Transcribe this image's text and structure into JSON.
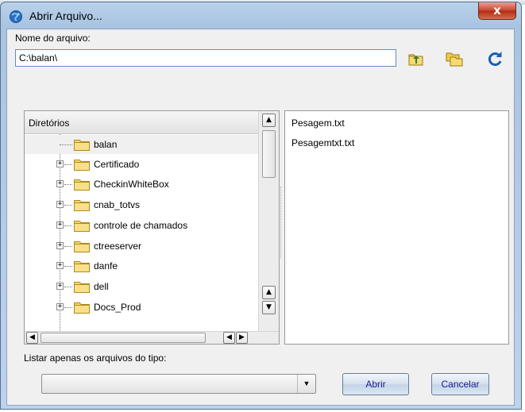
{
  "window": {
    "title": "Abrir Arquivo...",
    "close_symbol": "x"
  },
  "filename": {
    "label": "Nome do arquivo:",
    "value": "C:\\balan\\"
  },
  "toolbar": {
    "up_icon": "folder-up-icon",
    "new_folder_icon": "new-folder-icon",
    "refresh_icon": "refresh-icon"
  },
  "directories": {
    "header": "Diretórios",
    "items": [
      {
        "label": "balan",
        "selected": true,
        "expandable": false
      },
      {
        "label": "Certificado",
        "selected": false,
        "expandable": true
      },
      {
        "label": "CheckinWhiteBox",
        "selected": false,
        "expandable": true
      },
      {
        "label": "cnab_totvs",
        "selected": false,
        "expandable": true
      },
      {
        "label": "controle de chamados",
        "selected": false,
        "expandable": true
      },
      {
        "label": "ctreeserver",
        "selected": false,
        "expandable": true
      },
      {
        "label": "danfe",
        "selected": false,
        "expandable": true
      },
      {
        "label": "dell",
        "selected": false,
        "expandable": true
      },
      {
        "label": "Docs_Prod",
        "selected": false,
        "expandable": true
      }
    ]
  },
  "files": {
    "items": [
      "Pesagem.txt",
      "Pesagemtxt.txt"
    ]
  },
  "filter": {
    "label": "Listar apenas os arquivos do tipo:",
    "value": ""
  },
  "buttons": {
    "open": "Abrir",
    "cancel": "Cancelar"
  },
  "colors": {
    "title_bar": "#b9d1ea",
    "close_button": "#c7432e",
    "folder": "#f5d76e",
    "refresh": "#1a5fb4"
  }
}
